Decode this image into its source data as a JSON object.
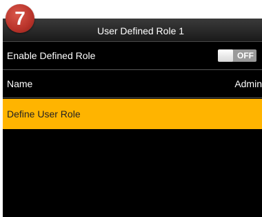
{
  "step_badge": "7",
  "header": {
    "title": "User Defined Role 1"
  },
  "rows": [
    {
      "label": "Enable Defined Role",
      "toggle": "OFF"
    },
    {
      "label": "Name",
      "value": "Admin"
    },
    {
      "label": "Define User Role"
    }
  ],
  "colors": {
    "highlight": "#ffb400",
    "badge": "#b8332a",
    "background": "#000000"
  }
}
